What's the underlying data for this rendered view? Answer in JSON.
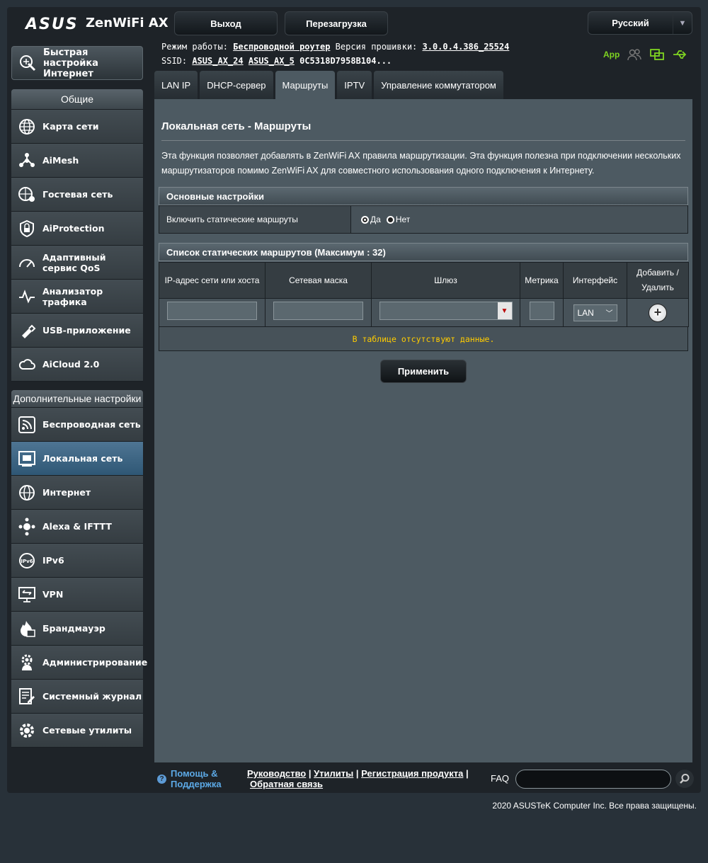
{
  "header": {
    "brand": "ASUS",
    "model": "ZenWiFi AX",
    "logout_label": "Выход",
    "reboot_label": "Перезагрузка",
    "language": "Русский"
  },
  "info": {
    "mode_label": "Режим работы:",
    "mode_value": "Беспроводной роутер",
    "fw_label": "Версия прошивки:",
    "fw_value": "3.0.0.4.386_25524",
    "ssid_label": "SSID:",
    "ssid_1": "ASUS_AX_24",
    "ssid_2": "ASUS_AX_5",
    "ssid_3": "0C5318D7958B104..."
  },
  "status": {
    "app_label": "App"
  },
  "sidebar": {
    "quick_setup": "Быстрая настройка Интернет",
    "general_header": "Общие",
    "general": [
      {
        "label": "Карта сети"
      },
      {
        "label": "AiMesh"
      },
      {
        "label": "Гостевая сеть"
      },
      {
        "label": "AiProtection"
      },
      {
        "label": "Адаптивный сервис QoS"
      },
      {
        "label": "Анализатор трафика"
      },
      {
        "label": "USB-приложение"
      },
      {
        "label": "AiCloud 2.0"
      }
    ],
    "advanced_header": "Дополнительные настройки",
    "advanced": [
      {
        "label": "Беспроводная сеть"
      },
      {
        "label": "Локальная сеть"
      },
      {
        "label": "Интернет"
      },
      {
        "label": "Alexa & IFTTT"
      },
      {
        "label": "IPv6"
      },
      {
        "label": "VPN"
      },
      {
        "label": "Брандмауэр"
      },
      {
        "label": "Администрирование"
      },
      {
        "label": "Системный журнал"
      },
      {
        "label": "Сетевые утилиты"
      }
    ]
  },
  "tabs": [
    {
      "label": "LAN IP"
    },
    {
      "label": "DHCP-сервер"
    },
    {
      "label": "Маршруты"
    },
    {
      "label": "IPTV"
    },
    {
      "label": "Управление коммутатором"
    }
  ],
  "main": {
    "title": "Локальная сеть - Маршруты",
    "description": "Эта функция позволяет добавлять в ZenWiFi AX правила маршрутизации. Эта функция полезна при подключении нескольких маршрутизаторов помимо ZenWiFi AX для совместного использования одного подключения к Интернету.",
    "basic_header": "Основные настройки",
    "static_routes_label": "Включить статические маршруты",
    "yes_label": "Да",
    "no_label": "Нет",
    "list_header": "Список статических маршрутов (Максимум : 32)",
    "columns": [
      "IP-адрес сети или хоста",
      "Сетевая маска",
      "Шлюз",
      "Метрика",
      "Интерфейс",
      "Добавить / Удалить"
    ],
    "interface_value": "LAN",
    "empty_text": "В таблице отсутствуют данные.",
    "apply_label": "Применить"
  },
  "footer": {
    "help_label": "Помощь & Поддержка",
    "link_manual": "Руководство",
    "link_utils": "Утилиты",
    "link_register": "Регистрация продукта",
    "link_feedback": "Обратная связь",
    "faq_label": "FAQ",
    "copyright": "2020 ASUSTeK Computer Inc. Все права защищены."
  }
}
